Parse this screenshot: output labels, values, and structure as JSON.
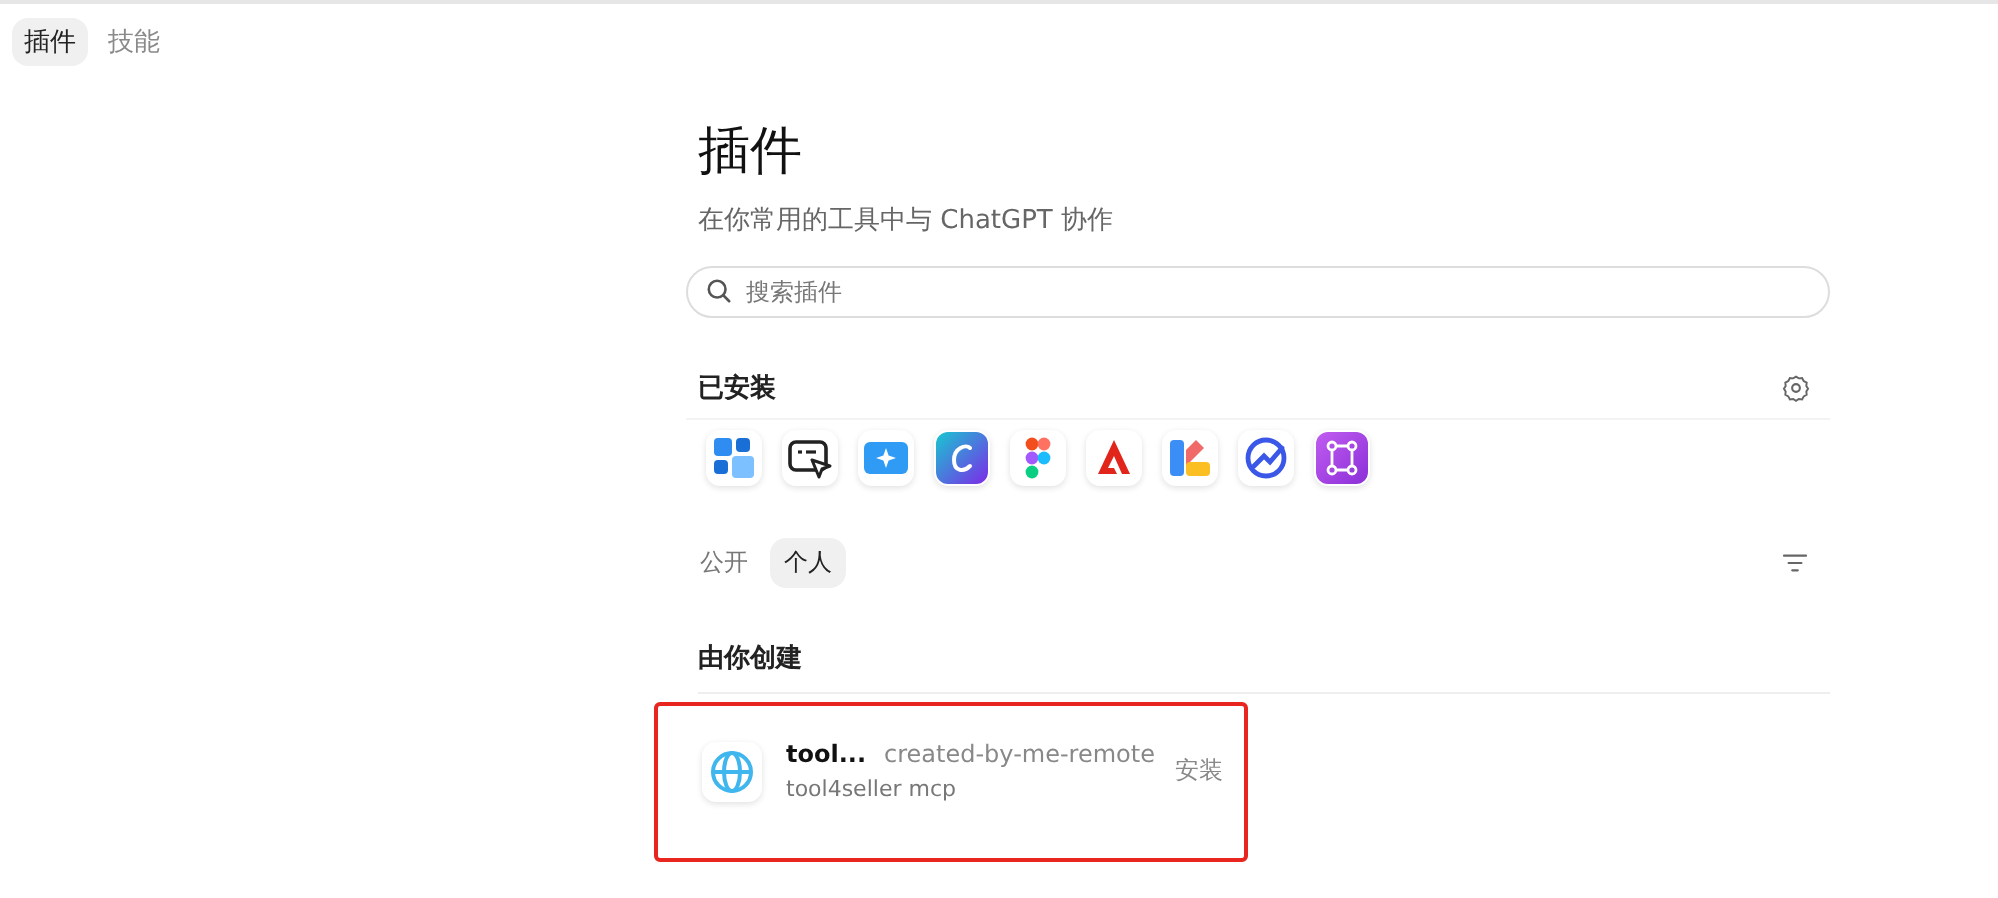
{
  "top_tabs": [
    {
      "label": "插件",
      "selected": true
    },
    {
      "label": "技能",
      "selected": false
    }
  ],
  "title": "插件",
  "subtitle": "在你常用的工具中与 ChatGPT 协作",
  "search": {
    "placeholder": "搜索插件"
  },
  "installed": {
    "heading": "已安装",
    "apps": [
      {
        "kind": "grid"
      },
      {
        "kind": "cursor"
      },
      {
        "kind": "sparkle"
      },
      {
        "kind": "canva"
      },
      {
        "kind": "figma"
      },
      {
        "kind": "adobe"
      },
      {
        "kind": "palette"
      },
      {
        "kind": "chart"
      },
      {
        "kind": "nodes"
      }
    ]
  },
  "filter_tabs": [
    {
      "label": "公开",
      "selected": false
    },
    {
      "label": "个人",
      "selected": true
    }
  ],
  "created": {
    "heading": "由你创建",
    "items": [
      {
        "name": "tool...",
        "tag": "created-by-me-remote",
        "description": "tool4seller mcp",
        "action": "安装",
        "highlighted": true
      }
    ]
  }
}
